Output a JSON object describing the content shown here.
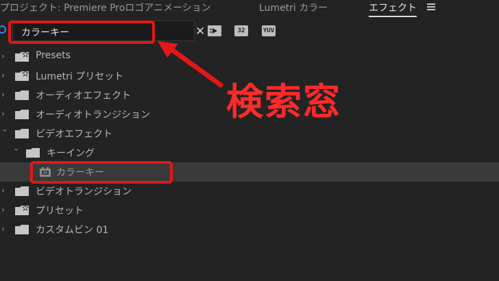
{
  "tabs": [
    {
      "label": "プロジェクト: Premiere Proロゴアニメーション",
      "active": false
    },
    {
      "label": "Lumetri カラー",
      "active": false
    },
    {
      "label": "エフェクト",
      "active": true
    }
  ],
  "search": {
    "value": "カラーキー",
    "clear": "✕"
  },
  "toolbar": {
    "accelerated_label": "",
    "bit32_label": "32",
    "yuv_label": "YUV"
  },
  "tree": [
    {
      "label": "Presets",
      "level": 0,
      "star": true
    },
    {
      "label": "Lumetri プリセット",
      "level": 0,
      "star": true
    },
    {
      "label": "オーディオエフェクト",
      "level": 0,
      "star": false
    },
    {
      "label": "オーディオトランジション",
      "level": 0,
      "star": false
    },
    {
      "label": "ビデオエフェクト",
      "level": 0,
      "star": false,
      "expanded": true
    },
    {
      "label": "キーイング",
      "level": 1,
      "star": false,
      "expanded": true
    },
    {
      "label": "カラーキー",
      "level": 2,
      "effect": true,
      "selected": true
    },
    {
      "label": "ビデオトランジション",
      "level": 0,
      "star": false
    },
    {
      "label": "プリセット",
      "level": 0,
      "star": true
    },
    {
      "label": "カスタムビン 01",
      "level": 0,
      "star": false
    }
  ],
  "annotation": {
    "label": "検索窓",
    "color": "#e01818"
  }
}
